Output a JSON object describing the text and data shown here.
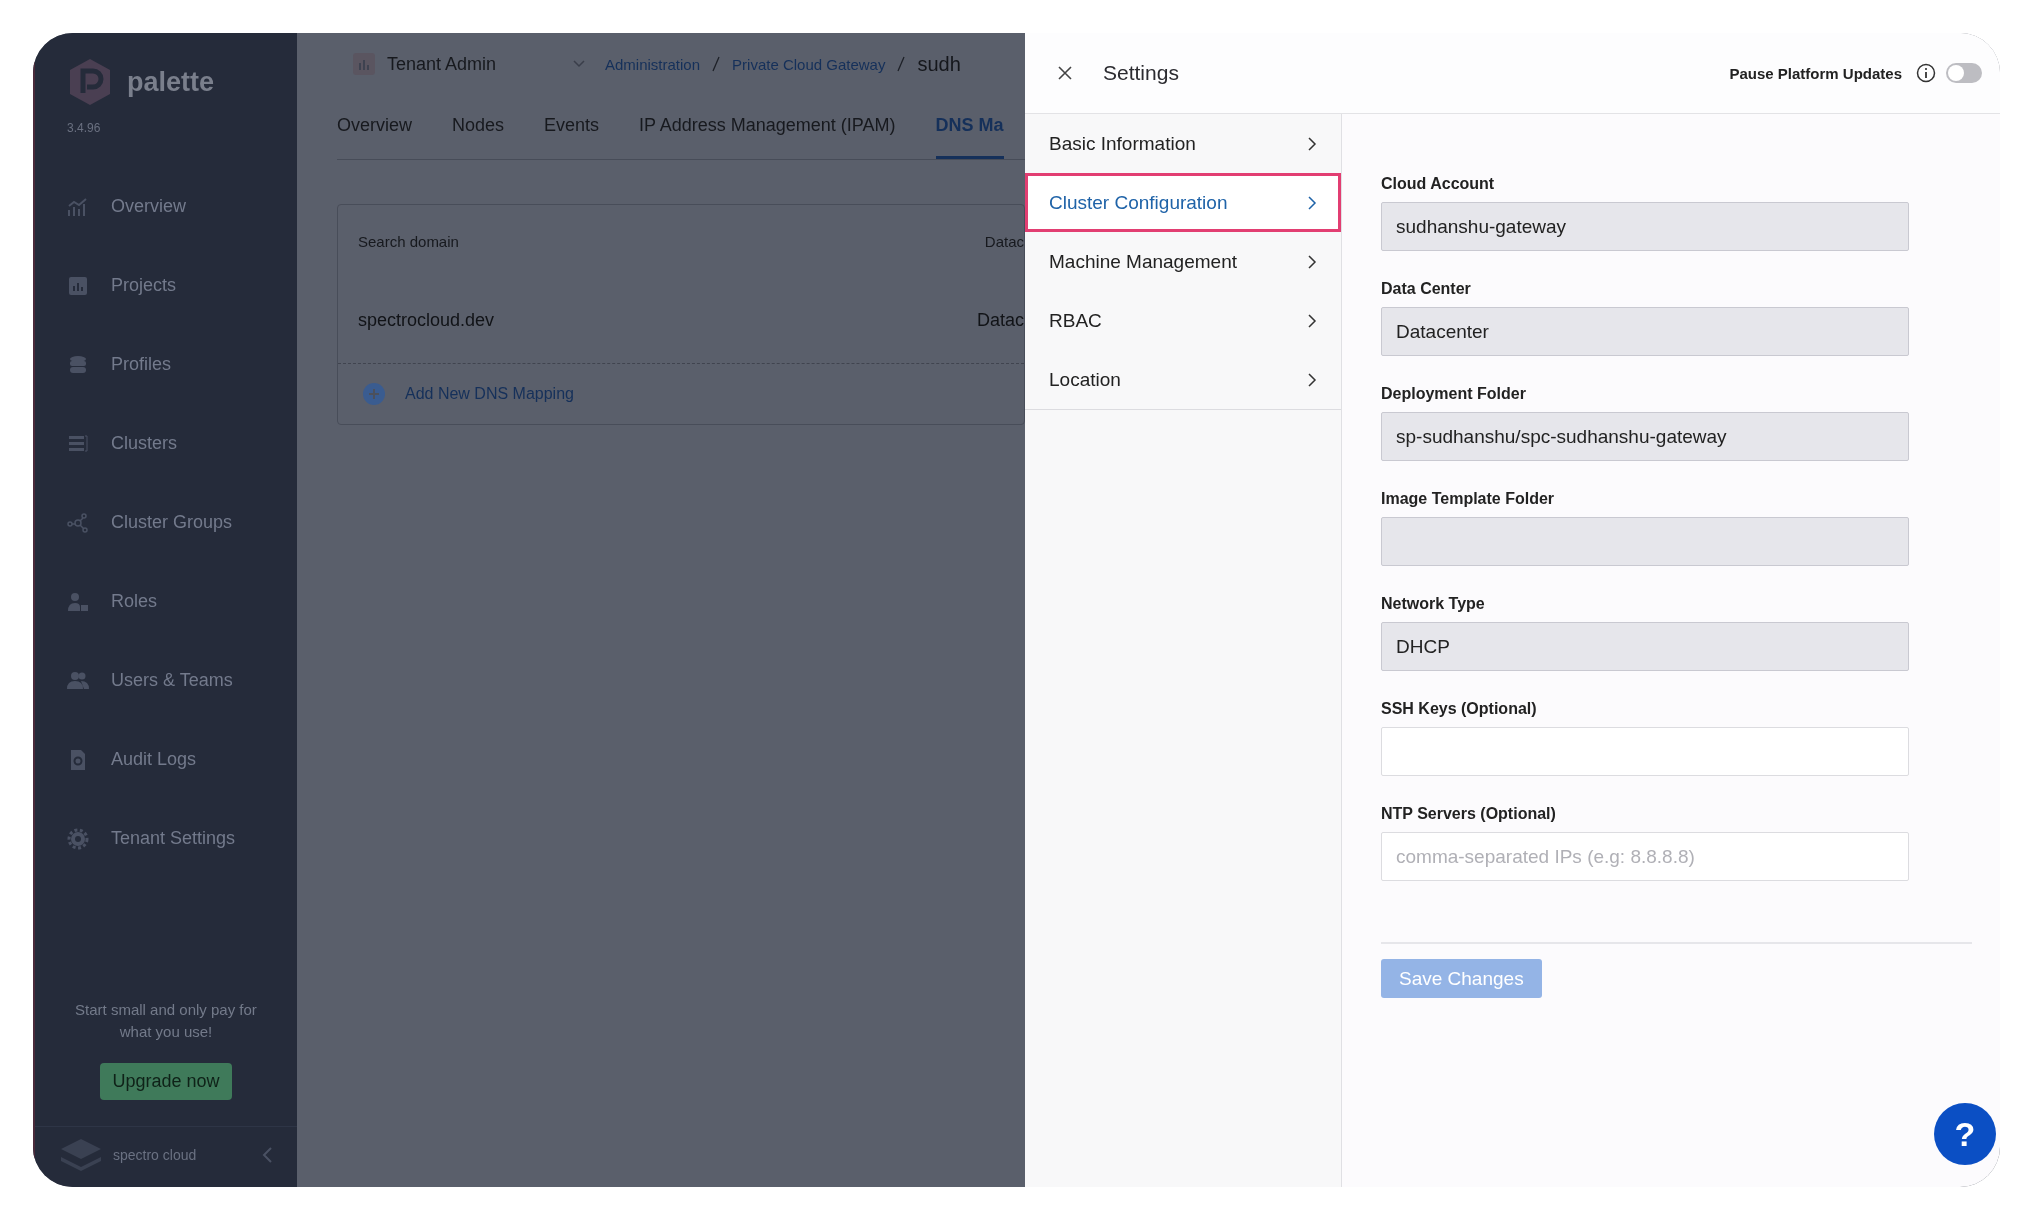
{
  "sidebar": {
    "logo": "palette",
    "version": "3.4.96",
    "items": [
      {
        "label": "Overview"
      },
      {
        "label": "Projects"
      },
      {
        "label": "Profiles"
      },
      {
        "label": "Clusters"
      },
      {
        "label": "Cluster Groups"
      },
      {
        "label": "Roles"
      },
      {
        "label": "Users & Teams"
      },
      {
        "label": "Audit Logs"
      },
      {
        "label": "Tenant Settings"
      }
    ],
    "promo": "Start small and only pay for what you use!",
    "upgrade_button": "Upgrade now",
    "footer_brand": "spectro cloud"
  },
  "header": {
    "scope": "Tenant Admin",
    "breadcrumbs": [
      "Administration",
      "Private Cloud Gateway",
      "sudh"
    ]
  },
  "tabs": [
    {
      "label": "Overview",
      "selected": false
    },
    {
      "label": "Nodes",
      "selected": false
    },
    {
      "label": "Events",
      "selected": false
    },
    {
      "label": "IP Address Management (IPAM)",
      "selected": false
    },
    {
      "label": "DNS Ma",
      "selected": true
    }
  ],
  "dns_table": {
    "columns": [
      "Search domain",
      "Datac"
    ],
    "rows": [
      [
        "spectrocloud.dev",
        "Datac"
      ]
    ],
    "add_action": "Add New DNS Mapping"
  },
  "settings": {
    "title": "Settings",
    "pause_updates": {
      "label": "Pause Platform Updates",
      "on": false
    },
    "nav": [
      {
        "label": "Basic Information",
        "selected": false
      },
      {
        "label": "Cluster Configuration",
        "selected": true
      },
      {
        "label": "Machine Management",
        "selected": false
      },
      {
        "label": "RBAC",
        "selected": false
      },
      {
        "label": "Location",
        "selected": false
      }
    ],
    "fields": [
      {
        "label": "Cloud Account",
        "value": "sudhanshu-gateway",
        "disabled": true
      },
      {
        "label": "Data Center",
        "value": "Datacenter",
        "disabled": true
      },
      {
        "label": "Deployment Folder",
        "value": "sp-sudhanshu/spc-sudhanshu-gateway",
        "disabled": true
      },
      {
        "label": "Image Template Folder",
        "disabled": true
      },
      {
        "label": "Network Type",
        "value": "DHCP",
        "disabled": true
      },
      {
        "label": "SSH Keys (Optional)",
        "disabled": false
      },
      {
        "label": "NTP Servers (Optional)",
        "placeholder": "comma-separated IPs (e.g: 8.8.8.8)",
        "disabled": false
      }
    ],
    "save_button": {
      "label": "Save Changes",
      "disabled": true
    },
    "help_button": "?"
  }
}
